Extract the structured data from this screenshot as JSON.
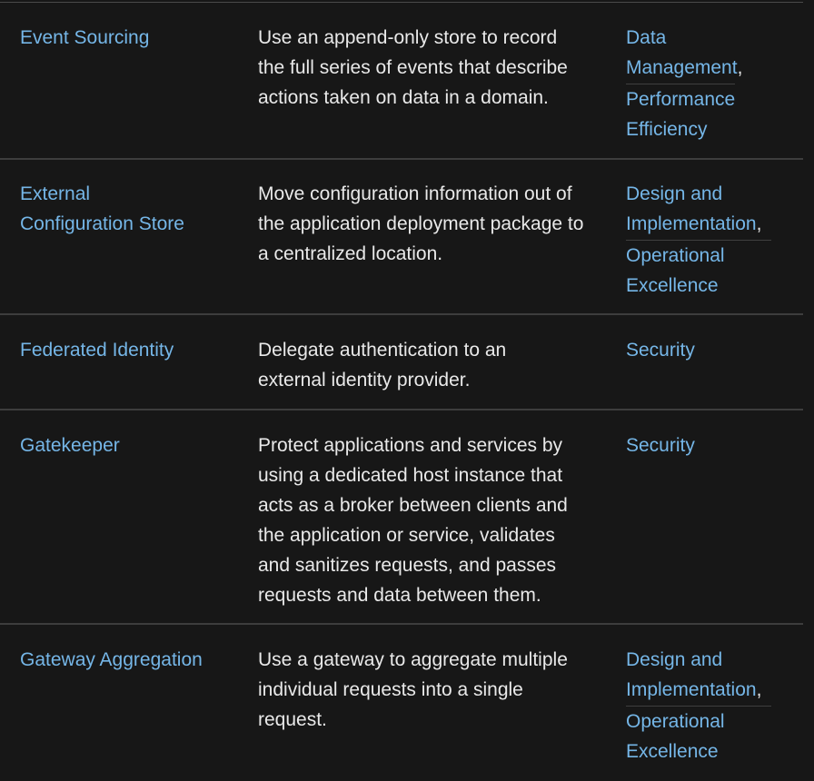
{
  "rows": [
    {
      "name": "Event Sourcing",
      "description": "Use an append-only store to record the full series of events that describe actions taken on data in a domain.",
      "categories": [
        "Data Management",
        "Performance Efficiency"
      ]
    },
    {
      "name": "External Configuration Store",
      "description": "Move configuration information out of the application deployment package to a centralized location.",
      "categories": [
        "Design and Implementation",
        "Operational Excellence"
      ]
    },
    {
      "name": "Federated Identity",
      "description": "Delegate authentication to an external identity provider.",
      "categories": [
        "Security"
      ]
    },
    {
      "name": "Gatekeeper",
      "description": "Protect applications and services by using a dedicated host instance that acts as a broker between clients and the application or service, validates and sanitizes requests, and passes requests and data between them.",
      "categories": [
        "Security"
      ]
    },
    {
      "name": "Gateway Aggregation",
      "description": "Use a gateway to aggregate multiple individual requests into a single request.",
      "categories": [
        "Design and Implementation",
        "Operational Excellence"
      ]
    }
  ],
  "separator": ","
}
